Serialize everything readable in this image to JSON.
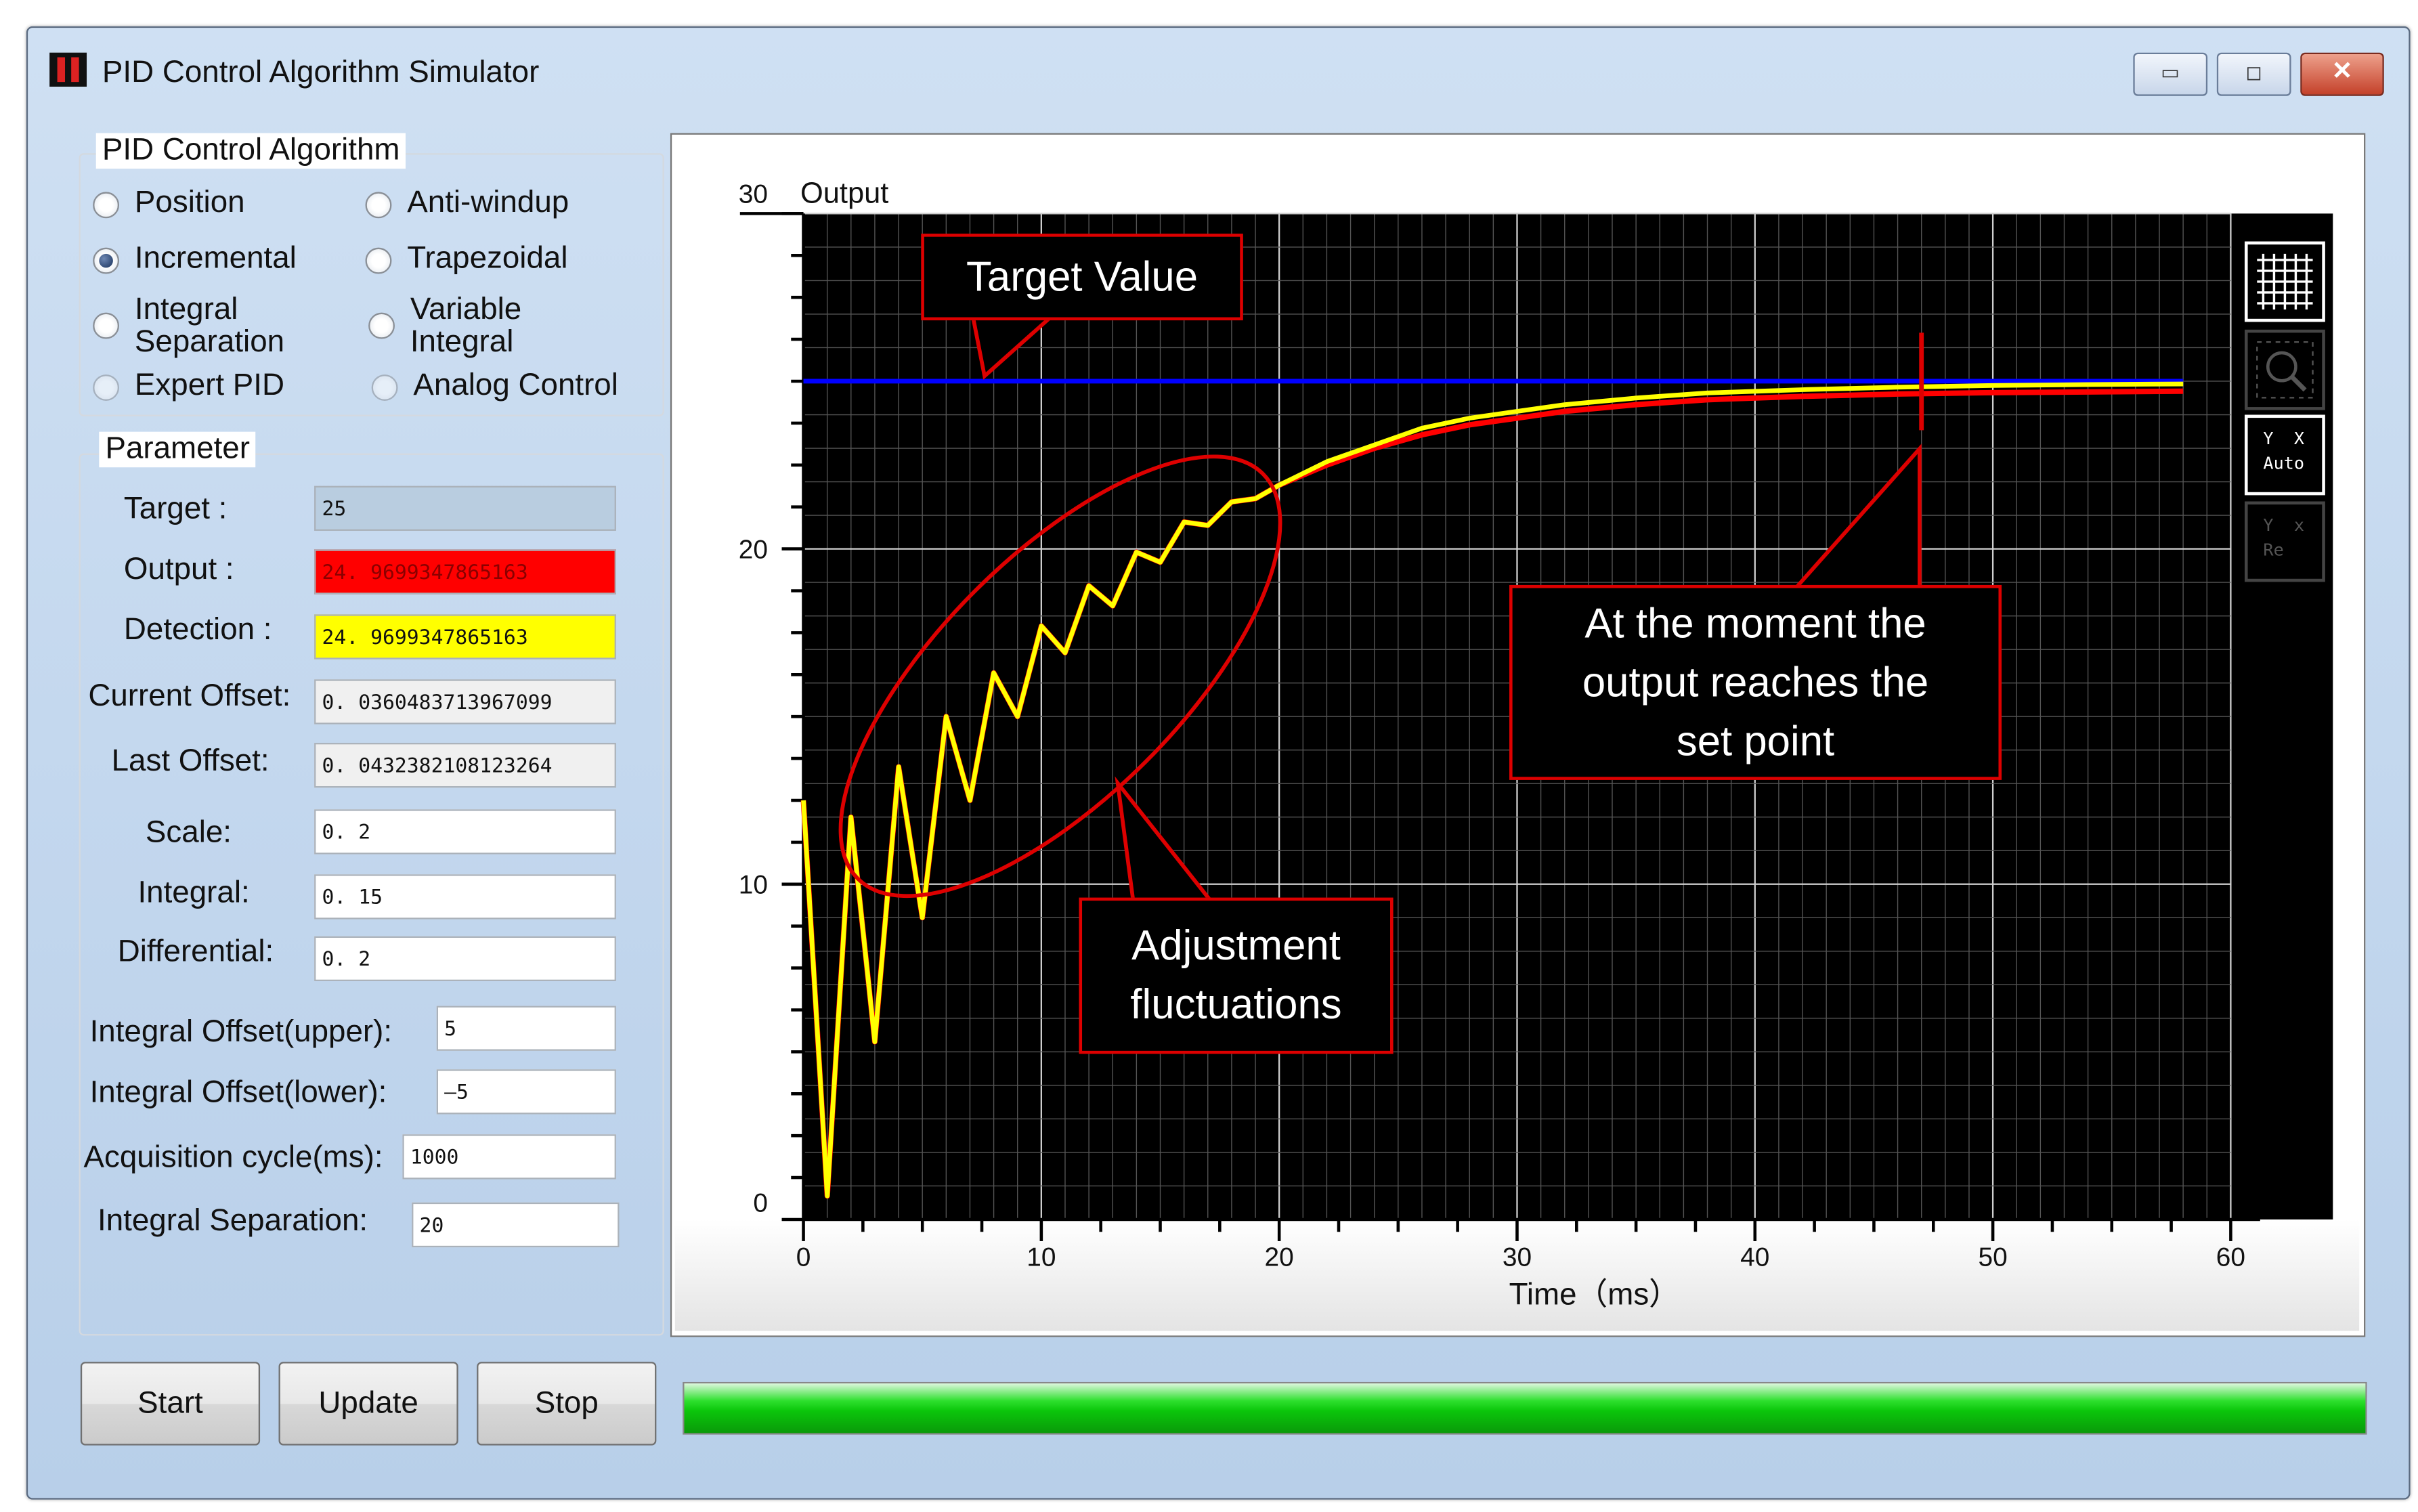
{
  "window": {
    "title": "PID Control Algorithm Simulator",
    "controls": {
      "minimize": "▭",
      "maximize": "◻",
      "close": "✕"
    }
  },
  "algorithm": {
    "title": "PID Control Algorithm",
    "options": [
      {
        "label": "Position",
        "selected": false,
        "enabled": true
      },
      {
        "label": "Anti-windup",
        "selected": false,
        "enabled": true
      },
      {
        "label": "Incremental",
        "selected": true,
        "enabled": true
      },
      {
        "label": "Trapezoidal",
        "selected": false,
        "enabled": true
      },
      {
        "label": "Integral\nSeparation",
        "selected": false,
        "enabled": true
      },
      {
        "label": "Variable\nIntegral",
        "selected": false,
        "enabled": true
      },
      {
        "label": "Expert PID",
        "selected": false,
        "enabled": false
      },
      {
        "label": "Analog Control",
        "selected": false,
        "enabled": false
      }
    ]
  },
  "parameters": {
    "title": "Parameter",
    "fields": [
      {
        "label": "Target :",
        "value": "25"
      },
      {
        "label": "Output :",
        "value": "24. 9699347865163"
      },
      {
        "label": "Detection :",
        "value": "24. 9699347865163"
      },
      {
        "label": "Current Offset:",
        "value": "0. 0360483713967099"
      },
      {
        "label": "Last Offset:",
        "value": "0. 0432382108123264"
      },
      {
        "label": "Scale:",
        "value": "0. 2"
      },
      {
        "label": "Integral:",
        "value": "0. 15"
      },
      {
        "label": "Differential:",
        "value": "0. 2"
      },
      {
        "label": "Integral Offset(upper):",
        "value": "5"
      },
      {
        "label": "Integral Offset(lower):",
        "value": "‒5"
      },
      {
        "label": "Acquisition cycle(ms):",
        "value": "1000"
      },
      {
        "label": "Integral Separation:",
        "value": "20"
      }
    ]
  },
  "buttons": {
    "start": "Start",
    "update": "Update",
    "stop": "Stop"
  },
  "progress": {
    "value": 1.0
  },
  "chart_data": {
    "type": "line",
    "title": "Output",
    "xlabel": "Time（ms）",
    "ylabel": "",
    "xlim": [
      0,
      60
    ],
    "ylim": [
      0,
      30
    ],
    "x_ticks": [
      "0",
      "10",
      "20",
      "30",
      "40",
      "50",
      "60"
    ],
    "y_ticks": [
      "0",
      "10",
      "20",
      "30"
    ],
    "grid": true,
    "colors": {
      "target": "#0000ff",
      "output": "#ff0000",
      "detection": "#ffff00",
      "annotation": "#dd0000"
    },
    "series": [
      {
        "key": "target",
        "points": [
          [
            0,
            25
          ],
          [
            58,
            25
          ]
        ]
      },
      {
        "key": "output",
        "points": [
          [
            0,
            12.5
          ],
          [
            1,
            0.7
          ],
          [
            2,
            12
          ],
          [
            3,
            5.3
          ],
          [
            4,
            13.5
          ],
          [
            5,
            9
          ],
          [
            6,
            15
          ],
          [
            7,
            12.5
          ],
          [
            8,
            16.3
          ],
          [
            9,
            15
          ],
          [
            10,
            17.7
          ],
          [
            11,
            16.9
          ],
          [
            12,
            18.9
          ],
          [
            13,
            18.3
          ],
          [
            14,
            19.9
          ],
          [
            15,
            19.6
          ],
          [
            16,
            20.8
          ],
          [
            17,
            20.7
          ],
          [
            18,
            21.4
          ],
          [
            19,
            21.5
          ],
          [
            20,
            21.9
          ],
          [
            22,
            22.5
          ],
          [
            24,
            23.0
          ],
          [
            26,
            23.4
          ],
          [
            28,
            23.7
          ],
          [
            30,
            23.9
          ],
          [
            32,
            24.1
          ],
          [
            35,
            24.3
          ],
          [
            38,
            24.45
          ],
          [
            42,
            24.55
          ],
          [
            46,
            24.62
          ],
          [
            50,
            24.66
          ],
          [
            54,
            24.68
          ],
          [
            58,
            24.7
          ]
        ]
      },
      {
        "key": "detection",
        "points": [
          [
            0,
            12.5
          ],
          [
            1,
            0.7
          ],
          [
            2,
            12
          ],
          [
            3,
            5.3
          ],
          [
            4,
            13.5
          ],
          [
            5,
            9
          ],
          [
            6,
            15
          ],
          [
            7,
            12.5
          ],
          [
            8,
            16.3
          ],
          [
            9,
            15
          ],
          [
            10,
            17.7
          ],
          [
            11,
            16.9
          ],
          [
            12,
            18.9
          ],
          [
            13,
            18.3
          ],
          [
            14,
            19.9
          ],
          [
            15,
            19.6
          ],
          [
            16,
            20.8
          ],
          [
            17,
            20.7
          ],
          [
            18,
            21.4
          ],
          [
            19,
            21.5
          ],
          [
            20,
            21.9
          ],
          [
            22,
            22.6
          ],
          [
            24,
            23.1
          ],
          [
            26,
            23.6
          ],
          [
            28,
            23.9
          ],
          [
            30,
            24.1
          ],
          [
            32,
            24.3
          ],
          [
            35,
            24.5
          ],
          [
            38,
            24.65
          ],
          [
            42,
            24.75
          ],
          [
            46,
            24.82
          ],
          [
            50,
            24.87
          ],
          [
            54,
            24.9
          ],
          [
            58,
            24.92
          ]
        ]
      }
    ],
    "annotations": {
      "target_value": "Target  Value",
      "moment": "At the moment the\noutput reaches the\nset point",
      "fluctuations": "Adjustment\nfluctuations",
      "marker_x": 47
    }
  },
  "chart_tools": [
    {
      "name": "grid-toggle",
      "label": ""
    },
    {
      "name": "zoom",
      "label": ""
    },
    {
      "name": "y-auto",
      "label": "Y  X\nAuto"
    },
    {
      "name": "y-reset",
      "label": "Y  x\nRe"
    }
  ]
}
